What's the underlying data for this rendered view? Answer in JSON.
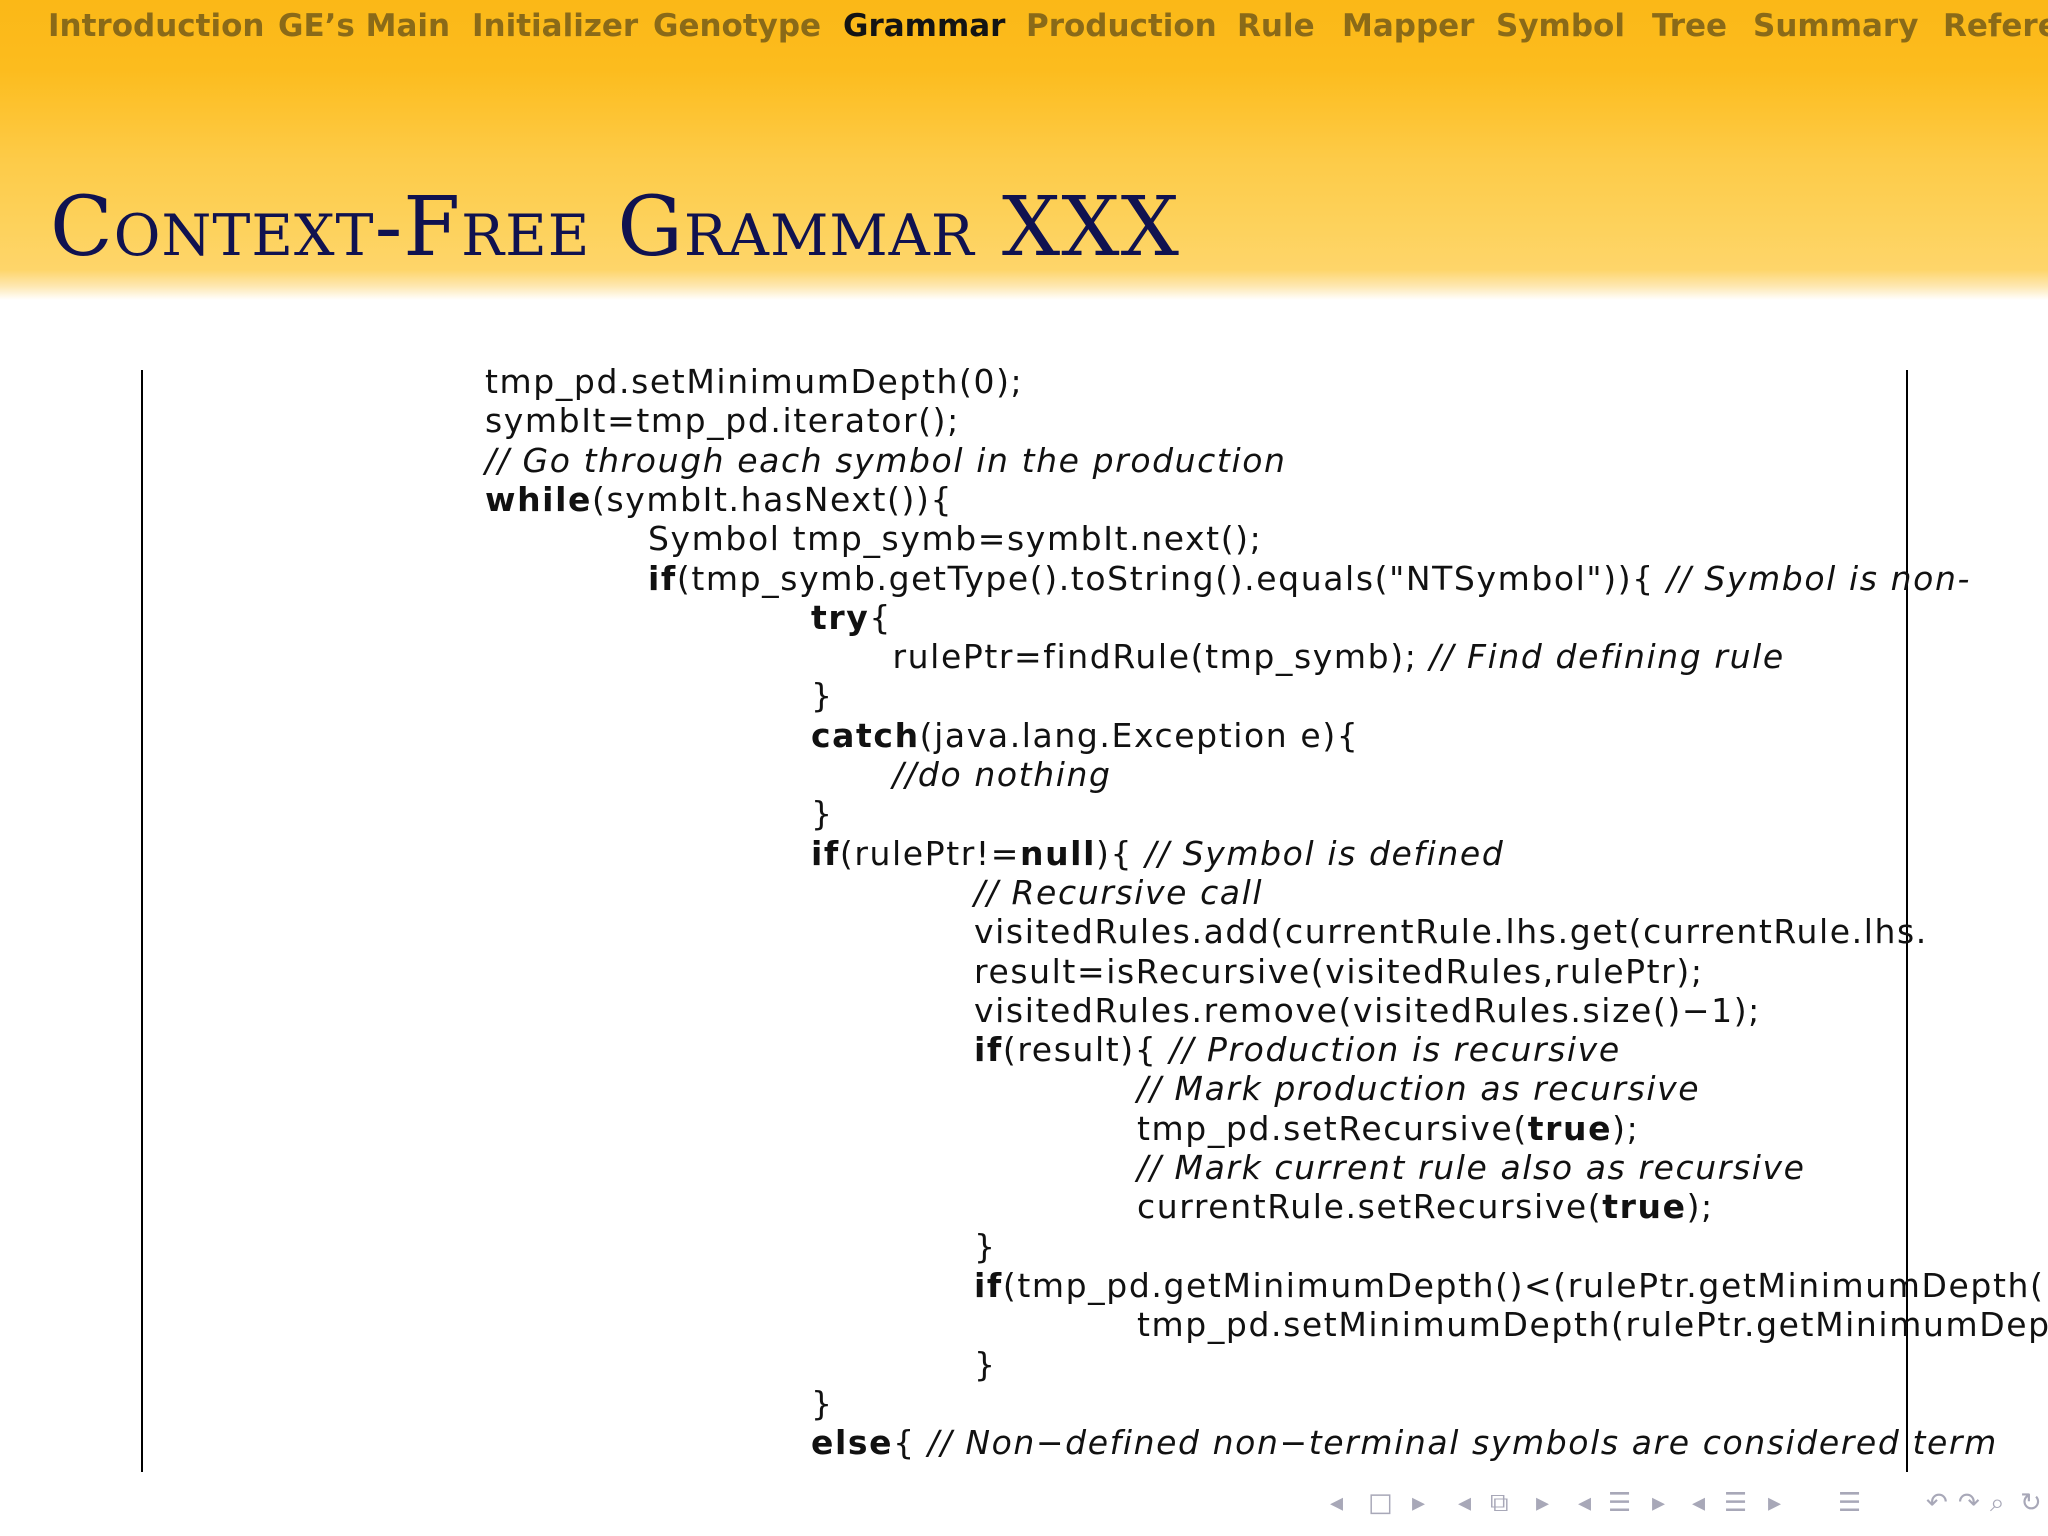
{
  "nav": {
    "items": [
      {
        "label": "Introduction",
        "active": false
      },
      {
        "label": "GE’s Main",
        "active": false
      },
      {
        "label": "Initializer",
        "active": false
      },
      {
        "label": "Genotype",
        "active": false
      },
      {
        "label": "Grammar",
        "active": true
      },
      {
        "label": "Production",
        "active": false
      },
      {
        "label": "Rule",
        "active": false
      },
      {
        "label": "Mapper",
        "active": false
      },
      {
        "label": "Symbol",
        "active": false
      },
      {
        "label": "Tree",
        "active": false
      },
      {
        "label": "Summary",
        "active": false
      },
      {
        "label": "Refere",
        "active": false
      }
    ]
  },
  "slide": {
    "title": "Context-Free Grammar XXX"
  },
  "code": {
    "lines": [
      {
        "indent": 0,
        "parts": [
          [
            "n",
            "tmp_pd.setMinimumDepth(0);"
          ]
        ]
      },
      {
        "indent": 0,
        "parts": [
          [
            "n",
            "symbIt=tmp_pd.iterator();"
          ]
        ]
      },
      {
        "indent": 0,
        "parts": [
          [
            "i",
            "// Go through each symbol in the production"
          ]
        ]
      },
      {
        "indent": 0,
        "parts": [
          [
            "b",
            "while"
          ],
          [
            "n",
            "(symbIt.hasNext()){"
          ]
        ]
      },
      {
        "indent": 1,
        "parts": [
          [
            "n",
            "Symbol tmp_symb=symbIt.next();"
          ]
        ]
      },
      {
        "indent": 1,
        "parts": [
          [
            "b",
            "if"
          ],
          [
            "n",
            "(tmp_symb.getType().toString().equals(\"NTSymbol\")){ "
          ],
          [
            "i",
            "// Symbol is non-"
          ]
        ]
      },
      {
        "indent": 2,
        "parts": [
          [
            "b",
            "try"
          ],
          [
            "n",
            "{"
          ]
        ]
      },
      {
        "indent": 2.5,
        "parts": [
          [
            "n",
            "rulePtr=findRule(tmp_symb); "
          ],
          [
            "i",
            "// Find defining rule"
          ]
        ]
      },
      {
        "indent": 2,
        "parts": [
          [
            "n",
            "}"
          ]
        ]
      },
      {
        "indent": 2,
        "parts": [
          [
            "b",
            "catch"
          ],
          [
            "n",
            "(java.lang.Exception e){"
          ]
        ]
      },
      {
        "indent": 2.5,
        "parts": [
          [
            "i",
            "//do nothing"
          ]
        ]
      },
      {
        "indent": 2,
        "parts": [
          [
            "n",
            "}"
          ]
        ]
      },
      {
        "indent": 2,
        "parts": [
          [
            "b",
            "if"
          ],
          [
            "n",
            "(rulePtr!="
          ],
          [
            "b",
            "null"
          ],
          [
            "n",
            "){ "
          ],
          [
            "i",
            "// Symbol is defined"
          ]
        ]
      },
      {
        "indent": 3,
        "parts": [
          [
            "i",
            "// Recursive call"
          ]
        ]
      },
      {
        "indent": 3,
        "parts": [
          [
            "n",
            "visitedRules.add(currentRule.lhs.get(currentRule.lhs."
          ]
        ]
      },
      {
        "indent": 3,
        "parts": [
          [
            "n",
            "result=isRecursive(visitedRules,rulePtr);"
          ]
        ]
      },
      {
        "indent": 3,
        "parts": [
          [
            "n",
            "visitedRules.remove(visitedRules.size()−1);"
          ]
        ]
      },
      {
        "indent": 3,
        "parts": [
          [
            "b",
            "if"
          ],
          [
            "n",
            "(result){ "
          ],
          [
            "i",
            "// Production is recursive"
          ]
        ]
      },
      {
        "indent": 4,
        "parts": [
          [
            "i",
            "// Mark production as recursive"
          ]
        ]
      },
      {
        "indent": 4,
        "parts": [
          [
            "n",
            "tmp_pd.setRecursive("
          ],
          [
            "b",
            "true"
          ],
          [
            "n",
            ");"
          ]
        ]
      },
      {
        "indent": 4,
        "parts": [
          [
            "i",
            "// Mark current rule also as recursive"
          ]
        ]
      },
      {
        "indent": 4,
        "parts": [
          [
            "n",
            "currentRule.setRecursive("
          ],
          [
            "b",
            "true"
          ],
          [
            "n",
            ");"
          ]
        ]
      },
      {
        "indent": 3,
        "parts": [
          [
            "n",
            "}"
          ]
        ]
      },
      {
        "indent": 3,
        "parts": [
          [
            "b",
            "if"
          ],
          [
            "n",
            "(tmp_pd.getMinimumDepth()<(rulePtr.getMinimumDepth("
          ]
        ]
      },
      {
        "indent": 4,
        "parts": [
          [
            "n",
            "tmp_pd.setMinimumDepth(rulePtr.getMinimumDepth"
          ]
        ]
      },
      {
        "indent": 3,
        "parts": [
          [
            "n",
            "}"
          ]
        ]
      },
      {
        "indent": 2,
        "parts": [
          [
            "n",
            "}"
          ]
        ]
      },
      {
        "indent": 2,
        "parts": [
          [
            "b",
            "else"
          ],
          [
            "n",
            "{ "
          ],
          [
            "i",
            "// Non−defined non−terminal symbols are considered term"
          ]
        ]
      }
    ]
  },
  "beamer_nav": {
    "symbols": [
      {
        "glyph": "◂",
        "name": "prev-frame-arrow-icon"
      },
      {
        "glyph": "□",
        "name": "frame-icon"
      },
      {
        "glyph": "▸",
        "name": "next-frame-arrow-icon"
      },
      {
        "glyph": "◂",
        "name": "prev-subsection-arrow-icon"
      },
      {
        "glyph": "⧉",
        "name": "subsection-icon"
      },
      {
        "glyph": "▸",
        "name": "next-subsection-arrow-icon"
      },
      {
        "glyph": "◂",
        "name": "prev-section-arrow-icon"
      },
      {
        "glyph": "☰",
        "name": "section-icon"
      },
      {
        "glyph": "▸",
        "name": "next-section-arrow-icon"
      },
      {
        "glyph": "◂",
        "name": "prev-document-arrow-icon"
      },
      {
        "glyph": "☰",
        "name": "document-icon"
      },
      {
        "glyph": "▸",
        "name": "next-document-arrow-icon"
      },
      {
        "glyph": "☰",
        "name": "appendix-icon"
      },
      {
        "glyph": "↶",
        "name": "back-icon"
      },
      {
        "glyph": "↷",
        "name": "forward-icon"
      },
      {
        "glyph": "⌕",
        "name": "search-icon"
      },
      {
        "glyph": "↻",
        "name": "refresh-icon"
      }
    ]
  }
}
